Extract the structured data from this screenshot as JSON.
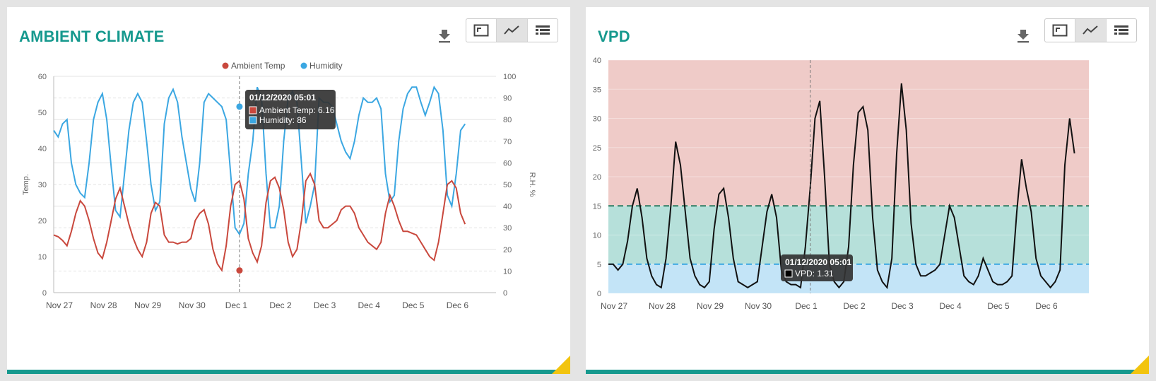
{
  "panels": [
    {
      "title": "AMBIENT CLIMATE",
      "icons": {
        "download": "download-icon",
        "expand": "expand-icon",
        "chart": "line-chart-icon",
        "table": "table-icon"
      }
    },
    {
      "title": "VPD",
      "icons": {
        "download": "download-icon",
        "expand": "expand-icon",
        "chart": "line-chart-icon",
        "table": "table-icon"
      }
    }
  ],
  "colors": {
    "accent": "#16998e",
    "temp": "#c9483d",
    "humidity": "#3ba7e2",
    "vpd_line": "#111111",
    "zone_high": "#efcbc8",
    "zone_mid": "#b6e0da",
    "zone_low": "#c3e4f7",
    "corner": "#f2c40f"
  },
  "chart_data": [
    {
      "type": "line",
      "title": "",
      "legend": [
        "Ambient Temp",
        "Humidity"
      ],
      "legend_position": "top",
      "x_ticks": [
        "Nov 27",
        "Nov 28",
        "Nov 29",
        "Nov 30",
        "Dec 1",
        "Dec 2",
        "Dec 3",
        "Dec 4",
        "Dec 5",
        "Dec 6"
      ],
      "ylabel": "Temp.",
      "y2label": "R.H. %",
      "ylim": [
        0,
        60
      ],
      "y2lim": [
        0,
        100
      ],
      "y_ticks": [
        "0",
        "10",
        "20",
        "30",
        "40",
        "50",
        "60"
      ],
      "y2_ticks": [
        "0",
        "10",
        "20",
        "30",
        "40",
        "50",
        "60",
        "70",
        "80",
        "90",
        "100"
      ],
      "x": [
        0,
        0.1,
        0.2,
        0.3,
        0.4,
        0.5,
        0.6,
        0.7,
        0.8,
        0.9,
        1,
        1.1,
        1.2,
        1.3,
        1.4,
        1.5,
        1.6,
        1.7,
        1.8,
        1.9,
        2,
        2.1,
        2.2,
        2.3,
        2.4,
        2.5,
        2.6,
        2.7,
        2.8,
        2.9,
        3,
        3.1,
        3.2,
        3.3,
        3.4,
        3.5,
        3.6,
        3.7,
        3.8,
        3.9,
        4,
        4.1,
        4.2,
        4.3,
        4.4,
        4.5,
        4.6,
        4.7,
        4.8,
        4.9,
        5,
        5.1,
        5.2,
        5.3,
        5.4,
        5.5,
        5.6,
        5.7,
        5.8,
        5.9,
        6,
        6.1,
        6.2,
        6.3,
        6.4,
        6.5,
        6.6,
        6.7,
        6.8,
        6.9,
        7,
        7.1,
        7.2,
        7.3,
        7.4,
        7.5,
        7.6,
        7.7,
        7.8,
        7.9,
        8,
        8.1,
        8.2,
        8.3,
        8.4,
        8.5,
        8.6,
        8.7,
        8.8,
        8.9,
        9,
        9.1,
        9.2,
        9.3,
        9.4,
        9.5,
        9.6,
        9.7,
        9.8,
        9.9
      ],
      "series": [
        {
          "name": "Ambient Temp",
          "axis": "left",
          "values": [
            16,
            15.5,
            14.5,
            13,
            17,
            22,
            25.5,
            24,
            20,
            15,
            11,
            9.5,
            14,
            20,
            26,
            29,
            24,
            19,
            15,
            12,
            10,
            14,
            22,
            25,
            24,
            16,
            14,
            14,
            13.5,
            14,
            14,
            15,
            20,
            22,
            23,
            19,
            12,
            8,
            6.2,
            13,
            24,
            30,
            31,
            26,
            15,
            11,
            8.5,
            13,
            25,
            31,
            32,
            29,
            23,
            14,
            10,
            12,
            20,
            31,
            33,
            30,
            20,
            18,
            18,
            19,
            20,
            23,
            24,
            24,
            22,
            18,
            16,
            14,
            13,
            12,
            14,
            22,
            27,
            24,
            20,
            17,
            17,
            16.5,
            16,
            14,
            12,
            10,
            9,
            14,
            22,
            30,
            31,
            29,
            22,
            19,
            18
          ]
        },
        {
          "name": "Humidity",
          "axis": "right",
          "values": [
            75,
            72,
            78,
            80,
            60,
            50,
            46,
            44,
            60,
            80,
            88,
            92,
            80,
            58,
            38,
            35,
            55,
            75,
            88,
            92,
            88,
            70,
            50,
            38,
            42,
            78,
            90,
            94,
            88,
            72,
            60,
            48,
            42,
            60,
            88,
            92,
            90,
            88,
            86,
            80,
            55,
            30,
            27,
            32,
            55,
            70,
            95,
            90,
            55,
            30,
            30,
            40,
            70,
            90,
            93,
            88,
            60,
            32,
            40,
            50,
            90,
            88,
            88,
            86,
            78,
            70,
            65,
            62,
            70,
            82,
            90,
            88,
            88,
            90,
            85,
            55,
            42,
            45,
            70,
            85,
            92,
            95,
            95,
            88,
            82,
            88,
            95,
            92,
            75,
            45,
            40,
            55,
            75,
            78
          ]
        }
      ],
      "tooltip": {
        "title": "01/12/2020 05:01",
        "rows": [
          "Ambient Temp: 6.16",
          "Humidity: 86"
        ]
      },
      "crosshair_x": 4.2
    },
    {
      "type": "area",
      "title": "",
      "x_ticks": [
        "Nov 27",
        "Nov 28",
        "Nov 29",
        "Nov 30",
        "Dec 1",
        "Dec 2",
        "Dec 3",
        "Dec 4",
        "Dec 5",
        "Dec 6"
      ],
      "ylabel": "VPD",
      "ylim": [
        0,
        40
      ],
      "y_ticks": [
        "0",
        "5",
        "10",
        "15",
        "20",
        "25",
        "30",
        "35",
        "40"
      ],
      "thresholds": [
        15,
        5
      ],
      "x": [
        0,
        0.1,
        0.2,
        0.3,
        0.4,
        0.5,
        0.6,
        0.7,
        0.8,
        0.9,
        1,
        1.1,
        1.2,
        1.3,
        1.4,
        1.5,
        1.6,
        1.7,
        1.8,
        1.9,
        2,
        2.1,
        2.2,
        2.3,
        2.4,
        2.5,
        2.6,
        2.7,
        2.8,
        2.9,
        3,
        3.1,
        3.2,
        3.3,
        3.4,
        3.5,
        3.6,
        3.7,
        3.8,
        3.9,
        4,
        4.1,
        4.2,
        4.3,
        4.4,
        4.5,
        4.6,
        4.7,
        4.8,
        4.9,
        5,
        5.1,
        5.2,
        5.3,
        5.4,
        5.5,
        5.6,
        5.7,
        5.8,
        5.9,
        6,
        6.1,
        6.2,
        6.3,
        6.4,
        6.5,
        6.6,
        6.7,
        6.8,
        6.9,
        7,
        7.1,
        7.2,
        7.3,
        7.4,
        7.5,
        7.6,
        7.7,
        7.8,
        7.9,
        8,
        8.1,
        8.2,
        8.3,
        8.4,
        8.5,
        8.6,
        8.7,
        8.8,
        8.9,
        9,
        9.1,
        9.2,
        9.3,
        9.4,
        9.5,
        9.6,
        9.7,
        9.8,
        9.9
      ],
      "series": [
        {
          "name": "VPD",
          "values": [
            5,
            5,
            4,
            5,
            9,
            15,
            18,
            13,
            6,
            3,
            1.5,
            1,
            6,
            15,
            26,
            22,
            14,
            6,
            3,
            1.5,
            1,
            2,
            11,
            17,
            18,
            13,
            6,
            2,
            1.5,
            1,
            1.5,
            2,
            8,
            14,
            17,
            13,
            4,
            2,
            1.5,
            1.5,
            1,
            8,
            18,
            30,
            33,
            20,
            5,
            2,
            1,
            2,
            8,
            22,
            31,
            32,
            28,
            13,
            4,
            2,
            1,
            6,
            24,
            36,
            28,
            12,
            5,
            3,
            3,
            3.5,
            4,
            5,
            10,
            15,
            13,
            8,
            3,
            2,
            1.5,
            3,
            6,
            4,
            2,
            1.5,
            1.5,
            2,
            3,
            14,
            23,
            18,
            14,
            6,
            3,
            2,
            1,
            2,
            4,
            22,
            30,
            24
          ]
        }
      ],
      "tooltip": {
        "title": "01/12/2020 05:01",
        "rows": [
          "VPD: 1.31"
        ]
      },
      "crosshair_x": 4.2
    }
  ]
}
